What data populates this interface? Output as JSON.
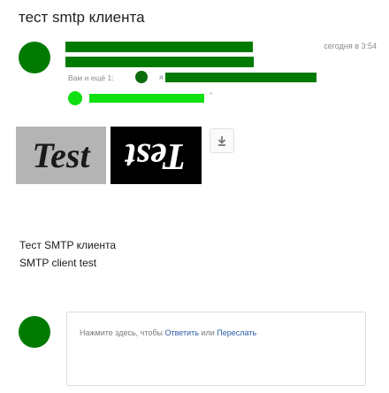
{
  "subject": "тест smtp клиента",
  "header": {
    "date": "сегодня в 3:54",
    "cc_label": "Вам и ещё 1:",
    "cc_initial": "я"
  },
  "attachments": [
    {
      "text": "Test"
    },
    {
      "text": "Test"
    }
  ],
  "icons": {
    "download": "download-icon",
    "expand": "chevron-up-icon"
  },
  "body": {
    "line1": "Тест SMTP клиента",
    "line2": "SMTP client test"
  },
  "reply": {
    "prefix": "Нажмите здесь, чтобы ",
    "reply_link": "Ответить",
    "middle": " или ",
    "forward_link": "Переслать"
  },
  "colors": {
    "redaction_dark": "#007a00",
    "redaction_bright": "#10e010",
    "link": "#2a5ca8"
  }
}
